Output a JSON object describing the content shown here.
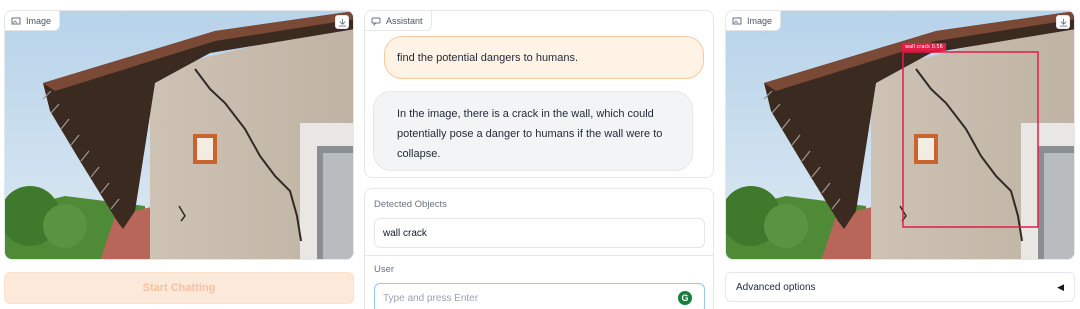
{
  "left_image": {
    "label": "Image"
  },
  "start_button": {
    "label": "Start Chatting"
  },
  "assistant": {
    "label": "Assistant",
    "messages": [
      {
        "role": "user",
        "text": "find the potential dangers to humans."
      },
      {
        "role": "bot",
        "text": "In the image, there is a crack in the wall, which could potentially pose a danger to humans if the wall were to collapse."
      }
    ]
  },
  "detected": {
    "label": "Detected Objects",
    "value": "wall crack"
  },
  "user_input": {
    "label": "User",
    "placeholder": "Type and press Enter",
    "grammarly_glyph": "G"
  },
  "right_image": {
    "label": "Image",
    "detection_label": "wall crack 0.56"
  },
  "advanced": {
    "label": "Advanced options",
    "toggle_icon": "◀"
  },
  "colors": {
    "accent": "#f97316",
    "bbox": "#e11d48"
  },
  "icons": [
    "image-icon",
    "download-icon",
    "chat-icon",
    "grammarly-icon",
    "triangle-left-icon"
  ]
}
